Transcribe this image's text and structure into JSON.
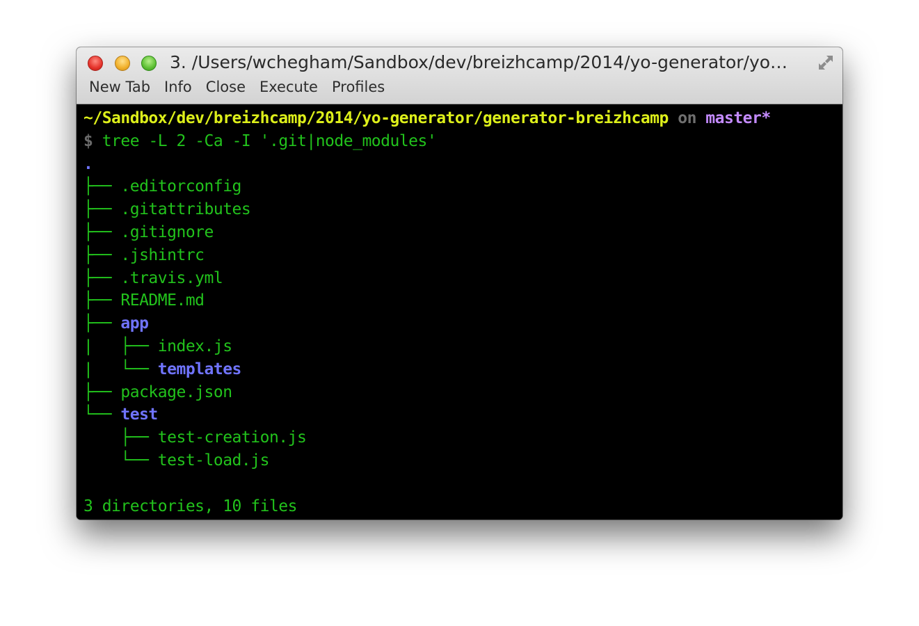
{
  "window": {
    "title": "3. /Users/wchegham/Sandbox/dev/breizhcamp/2014/yo-generator/yo…"
  },
  "toolbar": {
    "new_tab": "New Tab",
    "info": "Info",
    "close": "Close",
    "execute": "Execute",
    "profiles": "Profiles"
  },
  "prompt": {
    "path": "~/Sandbox/dev/breizhcamp/2014/yo-generator/generator-breizhcamp",
    "on": "on",
    "branch": "master*",
    "dollar": "$",
    "command": "tree -L 2 -Ca -I '.git|node_modules'"
  },
  "tree": [
    {
      "prefix": "",
      "name": ".",
      "type": "dir"
    },
    {
      "prefix": "├── ",
      "name": ".editorconfig",
      "type": "file"
    },
    {
      "prefix": "├── ",
      "name": ".gitattributes",
      "type": "file"
    },
    {
      "prefix": "├── ",
      "name": ".gitignore",
      "type": "file"
    },
    {
      "prefix": "├── ",
      "name": ".jshintrc",
      "type": "file"
    },
    {
      "prefix": "├── ",
      "name": ".travis.yml",
      "type": "file"
    },
    {
      "prefix": "├── ",
      "name": "README.md",
      "type": "file"
    },
    {
      "prefix": "├── ",
      "name": "app",
      "type": "dir"
    },
    {
      "prefix": "|   ├── ",
      "name": "index.js",
      "type": "file"
    },
    {
      "prefix": "|   └── ",
      "name": "templates",
      "type": "dir"
    },
    {
      "prefix": "├── ",
      "name": "package.json",
      "type": "file"
    },
    {
      "prefix": "└── ",
      "name": "test",
      "type": "dir"
    },
    {
      "prefix": "    ├── ",
      "name": "test-creation.js",
      "type": "file"
    },
    {
      "prefix": "    └── ",
      "name": "test-load.js",
      "type": "file"
    }
  ],
  "summary": "3 directories, 10 files",
  "colors": {
    "path": "#ddef1a",
    "branch": "#c48bff",
    "file": "#22c21c",
    "directory": "#7074ff",
    "background": "#000000"
  }
}
